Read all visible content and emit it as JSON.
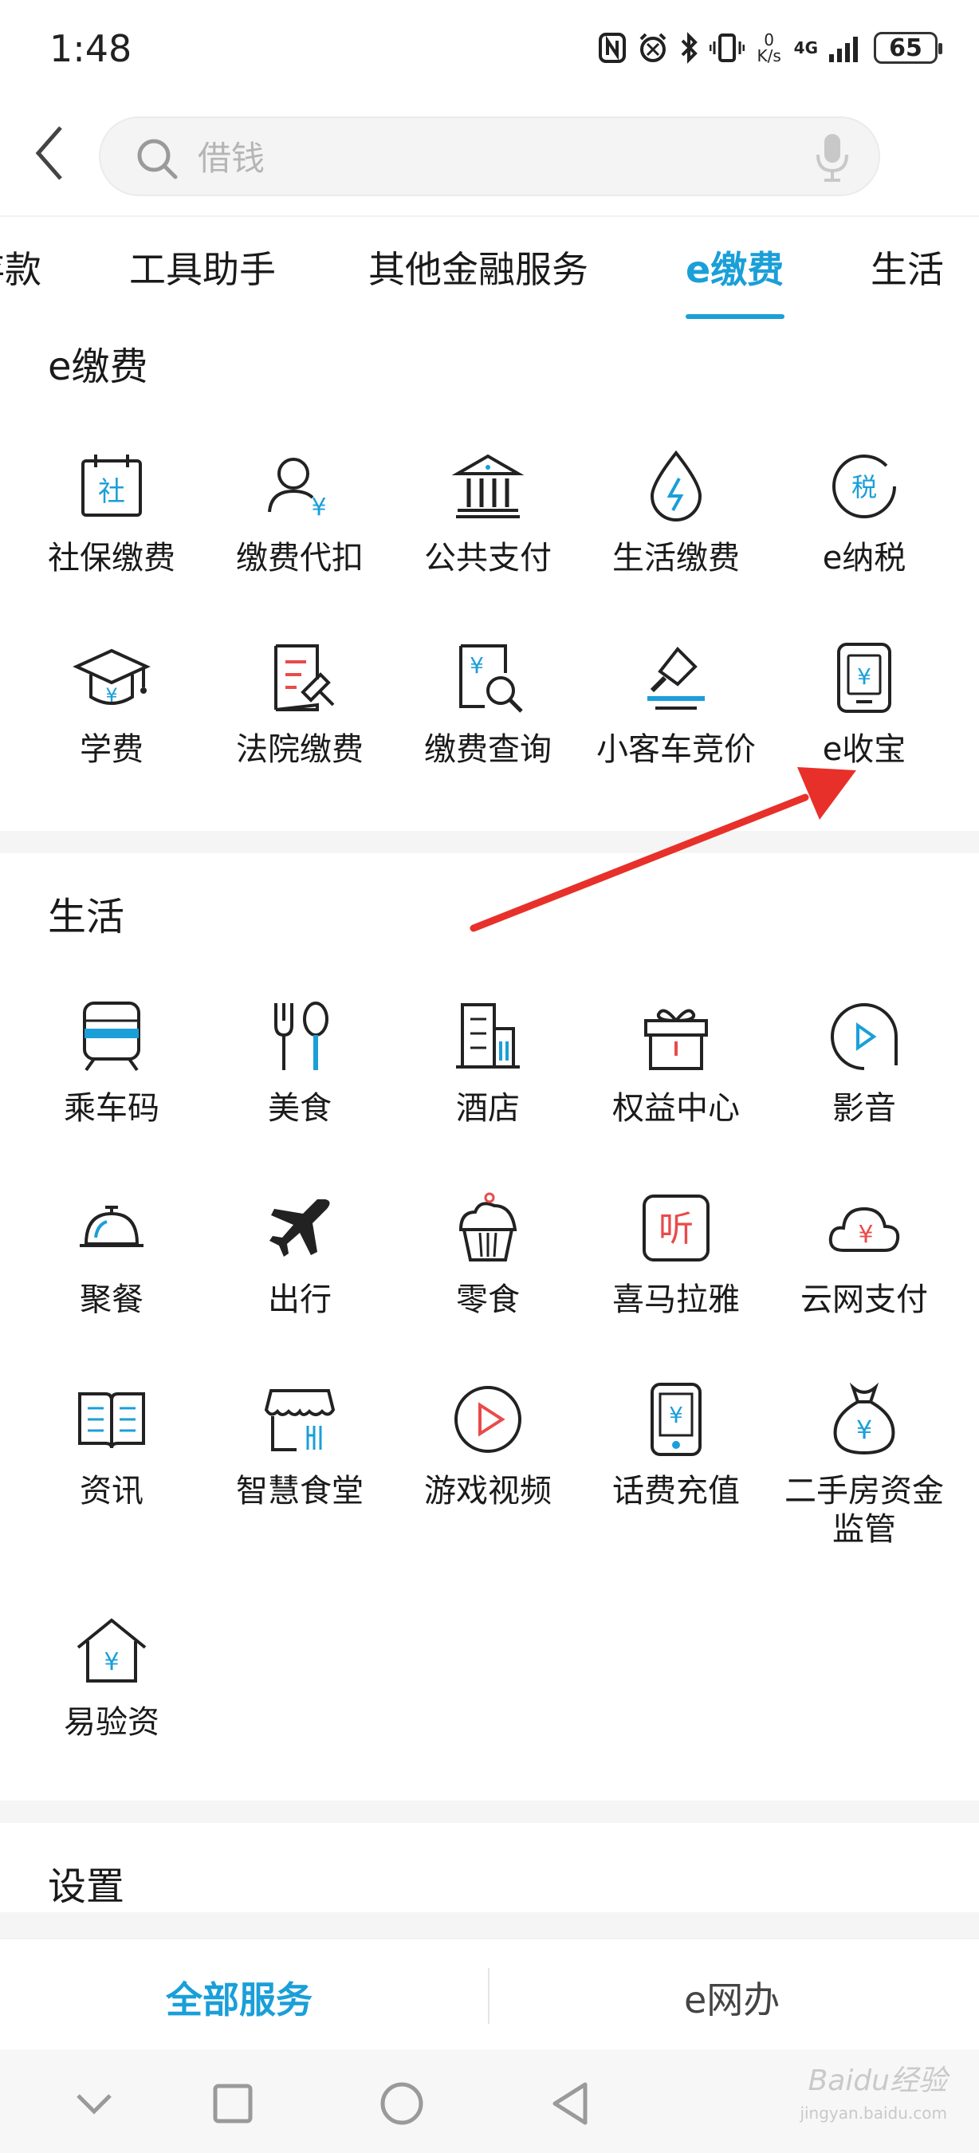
{
  "status_bar": {
    "time": "1:48",
    "battery": "65",
    "net_speed_top": "0",
    "net_speed_bottom": "K/s",
    "network": "4G",
    "icons": [
      "nfc-icon",
      "alarm-icon",
      "bluetooth-icon",
      "vibrate-icon",
      "signal-icon",
      "battery-icon"
    ]
  },
  "search": {
    "placeholder": "借钱"
  },
  "tabs": [
    {
      "label": "存款"
    },
    {
      "label": "工具助手"
    },
    {
      "label": "其他金融服务"
    },
    {
      "label": "e缴费",
      "active": true
    },
    {
      "label": "生活"
    }
  ],
  "sections": {
    "efee": {
      "title": "e缴费",
      "items": [
        {
          "label": "社保缴费",
          "icon": "social-security-icon"
        },
        {
          "label": "缴费代扣",
          "icon": "user-yuan-icon"
        },
        {
          "label": "公共支付",
          "icon": "bank-building-icon"
        },
        {
          "label": "生活缴费",
          "icon": "water-drop-bolt-icon"
        },
        {
          "label": "e纳税",
          "icon": "tax-icon"
        },
        {
          "label": "学费",
          "icon": "graduation-cap-icon"
        },
        {
          "label": "法院缴费",
          "icon": "court-document-icon"
        },
        {
          "label": "缴费查询",
          "icon": "fee-search-icon"
        },
        {
          "label": "小客车竞价",
          "icon": "auction-gavel-icon"
        },
        {
          "label": "e收宝",
          "icon": "receipt-card-icon"
        }
      ]
    },
    "life": {
      "title": "生活",
      "items": [
        {
          "label": "乘车码",
          "icon": "train-icon"
        },
        {
          "label": "美食",
          "icon": "fork-spoon-icon"
        },
        {
          "label": "酒店",
          "icon": "hotel-building-icon"
        },
        {
          "label": "权益中心",
          "icon": "gift-box-icon"
        },
        {
          "label": "影音",
          "icon": "play-circle-icon"
        },
        {
          "label": "聚餐",
          "icon": "cloche-icon"
        },
        {
          "label": "出行",
          "icon": "airplane-icon"
        },
        {
          "label": "零食",
          "icon": "cupcake-icon"
        },
        {
          "label": "喜马拉雅",
          "icon": "ximalaya-icon"
        },
        {
          "label": "云网支付",
          "icon": "cloud-yuan-icon"
        },
        {
          "label": "资讯",
          "icon": "book-news-icon"
        },
        {
          "label": "智慧食堂",
          "icon": "canteen-shop-icon"
        },
        {
          "label": "游戏视频",
          "icon": "video-play-icon"
        },
        {
          "label": "话费充值",
          "icon": "phone-recharge-icon"
        },
        {
          "label": "二手房资金\n监管",
          "icon": "money-bag-icon"
        },
        {
          "label": "易验资",
          "icon": "house-yuan-icon"
        }
      ]
    },
    "settings": {
      "title": "设置"
    }
  },
  "bottom_tabs": {
    "all_services": "全部服务",
    "e_office": "e网办"
  },
  "watermark": {
    "text": "Baidu经验",
    "sub": "jingyan.baidu.com"
  },
  "colors": {
    "accent": "#1a9fd8",
    "icon_blue": "#1a9fd8",
    "icon_red": "#e94b4b",
    "arrow_red": "#e8302a"
  }
}
